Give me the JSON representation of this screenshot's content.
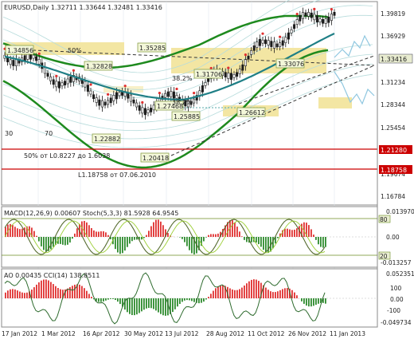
{
  "header": {
    "main_title": "EURUSD,Daily  1.32711 1.33644 1.32481 1.33416",
    "osc1_title": "MACD(12,26,9)  0.00607  Stoch(5,3,3) 81.5928 64.9545",
    "osc2_title": "AO 0.00435  CCI(14) 138.8511"
  },
  "colors": {
    "background": "#ffffff",
    "grid": "#d6dde6",
    "candle_up": "#1a1a1a",
    "candle_down": "#1a1a1a",
    "ma_teal": "#1f7f86",
    "bands_green": "#1e8a1e",
    "envelope_teal": "#9fd3d3",
    "zone_fill": "#f3e6a3",
    "support_red": "#cc0000",
    "fractal_red": "#e03030",
    "forecast_blue": "#8fc7e0",
    "osc_red": "#e03030",
    "osc_green": "#2e8b2e",
    "stoch_line": "#6b8e23",
    "price_marker": "#e8ecd0"
  },
  "price_scale": {
    "labels": [
      "1.39819",
      "1.36929",
      "1.34124",
      "1.31234",
      "1.28344",
      "1.25454",
      "1.22564",
      "1.19674",
      "1.16784",
      "1.13979"
    ],
    "current": "1.33416",
    "red_levels": [
      "1.21280",
      "1.18758"
    ]
  },
  "price_annotations": {
    "labels": [
      "1.34856",
      "1.32828",
      "1.35285",
      "1.31706",
      "1.33076",
      "1.27468",
      "1.25885",
      "1.26612",
      "1.22882",
      "1.20418"
    ],
    "fib_50": "50%",
    "fib_38a": "38.2%",
    "fib_38b": "38.2%",
    "note_30": "30",
    "note_70": "70",
    "note_fib": "50% от L0.8227 до 1.6038",
    "note_level": "L1.18758 от 07.06.2010"
  },
  "osc1_scale": {
    "labels": [
      "0.013970",
      "0.00",
      "-0.013257"
    ],
    "stoch_hi": "80",
    "stoch_lo": "20"
  },
  "osc2_scale": {
    "labels": [
      "0.052351",
      "100",
      "0.00",
      "-100",
      "-0.049734"
    ]
  },
  "time_axis": {
    "labels": [
      "17 Jan 2012",
      "1 Mar 2012",
      "16 Apr 2012",
      "30 May 2012",
      "13 Jul 2012",
      "28 Aug 2012",
      "11 Oct 2012",
      "26 Nov 2012",
      "11 Jan 2013"
    ]
  }
}
